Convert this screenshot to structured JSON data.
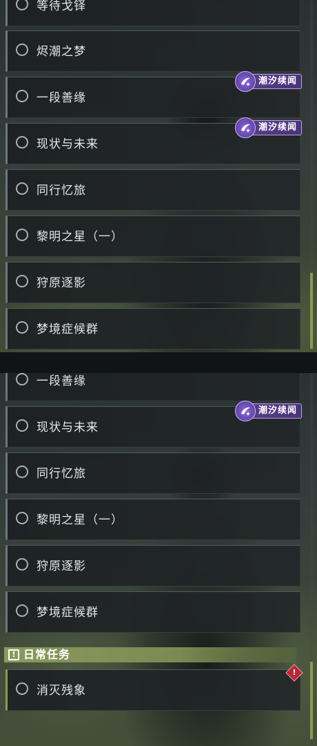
{
  "top_panel": {
    "quests": [
      {
        "label": "等待戈铎"
      },
      {
        "label": "烬潮之梦"
      },
      {
        "label": "一段善缘",
        "badge": "潮汐续闻"
      },
      {
        "label": "现状与未来",
        "badge": "潮汐续闻"
      },
      {
        "label": "同行忆旅"
      },
      {
        "label": "黎明之星（一）"
      },
      {
        "label": "狩原逐影"
      },
      {
        "label": "梦境症候群"
      }
    ]
  },
  "bottom_panel": {
    "quests": [
      {
        "label": "一段善缘"
      },
      {
        "label": "现状与未来",
        "badge": "潮汐续闻"
      },
      {
        "label": "同行忆旅"
      },
      {
        "label": "黎明之星（一）"
      },
      {
        "label": "狩原逐影"
      },
      {
        "label": "梦境症候群"
      }
    ],
    "daily_section": {
      "title": "日常任务",
      "icon": "exclamation-icon",
      "quests": [
        {
          "label": "消灭残象",
          "alert_icon": "diamond-alert-icon"
        }
      ]
    }
  },
  "colors": {
    "accent_green": "#8b9a58",
    "badge_purple": "#5a3f8e",
    "alert_red": "#b3283a"
  }
}
